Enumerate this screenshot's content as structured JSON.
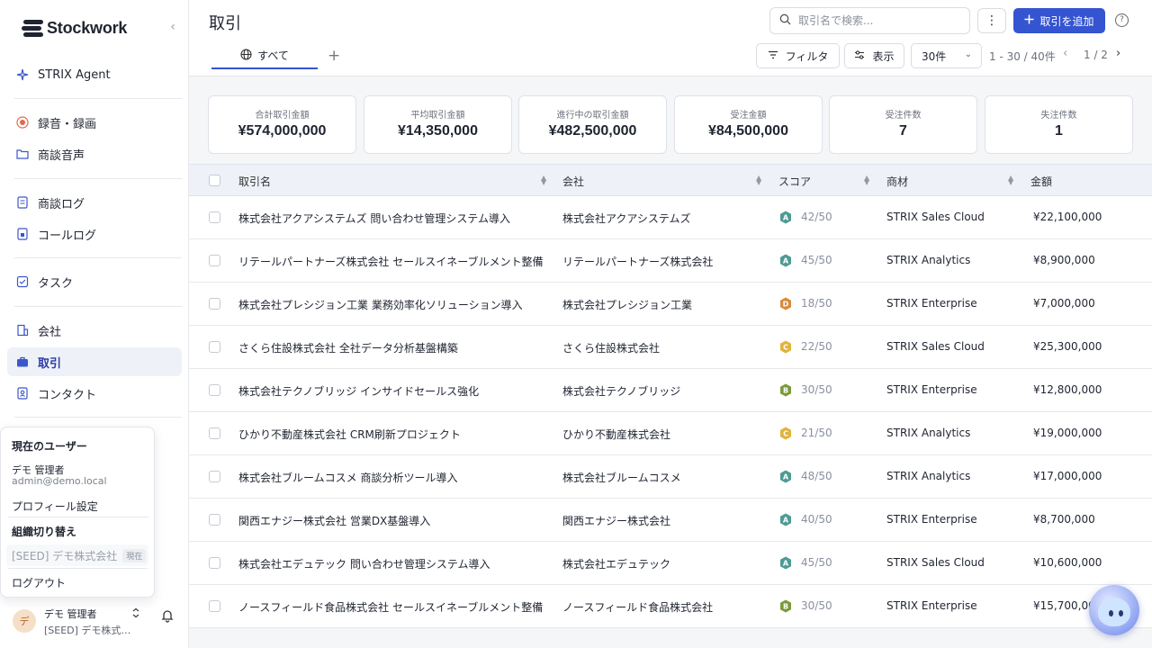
{
  "app": {
    "logo_text": "Stockwork",
    "page_title": "取引"
  },
  "sidebar": {
    "agent_label": "STRIX Agent",
    "items": [
      {
        "label": "録音・録画"
      },
      {
        "label": "商談音声"
      },
      {
        "label": "商談ログ"
      },
      {
        "label": "コールログ"
      },
      {
        "label": "タスク"
      },
      {
        "label": "会社"
      },
      {
        "label": "取引"
      },
      {
        "label": "コンタクト"
      }
    ]
  },
  "user_menu": {
    "title": "現在のユーザー",
    "name": "デモ 管理者",
    "email": "admin@demo.local",
    "profile_label": "プロフィール設定",
    "org_switch_title": "組織切り替え",
    "current_org": "[SEED] デモ株式会社",
    "current_badge": "現在",
    "logout_label": "ログアウト"
  },
  "user_bar": {
    "avatar_initial": "デ",
    "name": "デモ 管理者",
    "org": "[SEED] デモ株式…"
  },
  "header": {
    "search_placeholder": "取引名で検索...",
    "add_button": "取引を追加",
    "tab_all": "すべて",
    "filter_label": "フィルタ",
    "display_label": "表示",
    "per_page": "30件",
    "range": "1 - 30 / 40件",
    "page_info": "1 / 2"
  },
  "stats": [
    {
      "label": "合計取引金額",
      "value": "¥574,000,000"
    },
    {
      "label": "平均取引金額",
      "value": "¥14,350,000"
    },
    {
      "label": "進行中の取引金額",
      "value": "¥482,500,000"
    },
    {
      "label": "受注金額",
      "value": "¥84,500,000"
    },
    {
      "label": "受注件数",
      "value": "7"
    },
    {
      "label": "失注件数",
      "value": "1"
    }
  ],
  "table": {
    "columns": [
      "取引名",
      "会社",
      "スコア",
      "商材",
      "金額"
    ],
    "grade_colors": {
      "A": "#4f9a94",
      "B": "#7a9a3c",
      "C": "#e2b33c",
      "D": "#d98a3c"
    },
    "rows": [
      {
        "name": "株式会社アクアシステムズ 問い合わせ管理システム導入",
        "company": "株式会社アクアシステムズ",
        "grade": "A",
        "score": "42/50",
        "product": "STRIX Sales Cloud",
        "amount": "¥22,100,000"
      },
      {
        "name": "リテールパートナーズ株式会社 セールスイネーブルメント整備",
        "company": "リテールパートナーズ株式会社",
        "grade": "A",
        "score": "45/50",
        "product": "STRIX Analytics",
        "amount": "¥8,900,000"
      },
      {
        "name": "株式会社プレシジョン工業 業務効率化ソリューション導入",
        "company": "株式会社プレシジョン工業",
        "grade": "D",
        "score": "18/50",
        "product": "STRIX Enterprise",
        "amount": "¥7,000,000"
      },
      {
        "name": "さくら住設株式会社 全社データ分析基盤構築",
        "company": "さくら住設株式会社",
        "grade": "C",
        "score": "22/50",
        "product": "STRIX Sales Cloud",
        "amount": "¥25,300,000"
      },
      {
        "name": "株式会社テクノブリッジ インサイドセールス強化",
        "company": "株式会社テクノブリッジ",
        "grade": "B",
        "score": "30/50",
        "product": "STRIX Enterprise",
        "amount": "¥12,800,000"
      },
      {
        "name": "ひかり不動産株式会社 CRM刷新プロジェクト",
        "company": "ひかり不動産株式会社",
        "grade": "C",
        "score": "21/50",
        "product": "STRIX Analytics",
        "amount": "¥19,000,000"
      },
      {
        "name": "株式会社ブルームコスメ 商談分析ツール導入",
        "company": "株式会社ブルームコスメ",
        "grade": "A",
        "score": "48/50",
        "product": "STRIX Analytics",
        "amount": "¥17,000,000"
      },
      {
        "name": "関西エナジー株式会社 営業DX基盤導入",
        "company": "関西エナジー株式会社",
        "grade": "A",
        "score": "40/50",
        "product": "STRIX Enterprise",
        "amount": "¥8,700,000"
      },
      {
        "name": "株式会社エデュテック 問い合わせ管理システム導入",
        "company": "株式会社エデュテック",
        "grade": "A",
        "score": "45/50",
        "product": "STRIX Sales Cloud",
        "amount": "¥10,600,000"
      },
      {
        "name": "ノースフィールド食品株式会社 セールスイネーブルメント整備",
        "company": "ノースフィールド食品株式会社",
        "grade": "B",
        "score": "30/50",
        "product": "STRIX Enterprise",
        "amount": "¥15,700,000"
      }
    ]
  }
}
